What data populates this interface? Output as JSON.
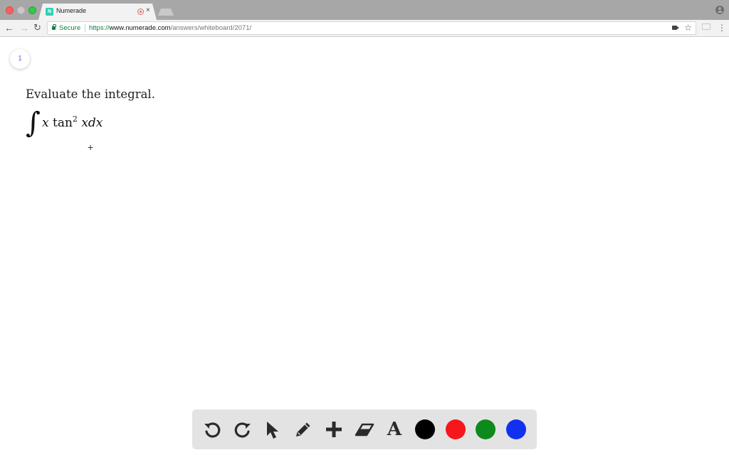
{
  "browser": {
    "tab": {
      "title": "Numerade",
      "favicon_letter": "N",
      "close_glyph": "×"
    },
    "nav": {
      "back_glyph": "←",
      "forward_glyph": "→",
      "reload_glyph": "↻"
    },
    "address": {
      "secure_label": "Secure",
      "url_scheme": "https://",
      "url_host": "www.numerade.com",
      "url_path": "/answers/whiteboard/2071/"
    },
    "star_glyph": "☆",
    "menu_glyph": "⋮"
  },
  "page": {
    "page_number": "1",
    "question": "Evaluate the integral.",
    "math": {
      "integral": "∫",
      "var_x": "x",
      "func": "tan",
      "power": "2",
      "tail": "xdx"
    },
    "cursor_glyph": "+"
  },
  "drawing_toolbar": {
    "tools": [
      "undo-icon",
      "redo-icon",
      "pointer-icon",
      "pencil-icon",
      "add-icon",
      "eraser-icon",
      "text-icon"
    ],
    "text_tool_glyph": "A",
    "colors": [
      "#000000",
      "#f5171b",
      "#0d8a1b",
      "#1230f0"
    ]
  }
}
